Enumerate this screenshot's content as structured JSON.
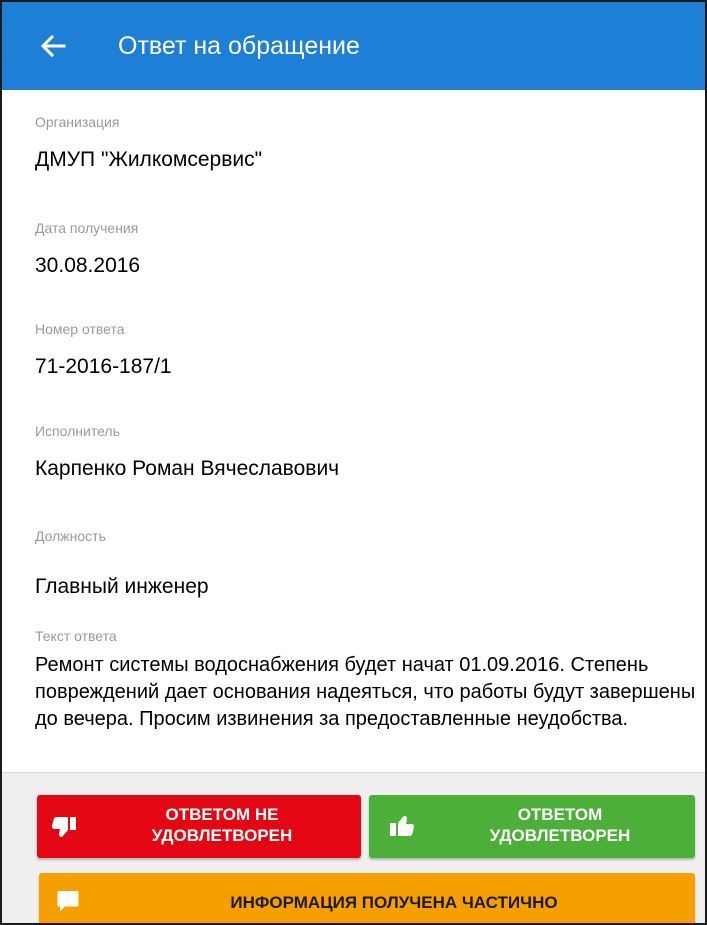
{
  "header": {
    "title": "Ответ на обращение",
    "back_icon": "arrow-left-icon"
  },
  "fields": {
    "organization": {
      "label": "Организация",
      "value": "ДМУП \"Жилкомсервис\""
    },
    "received_date": {
      "label": "Дата получения",
      "value": "30.08.2016"
    },
    "answer_number": {
      "label": "Номер ответа",
      "value": "71-2016-187/1"
    },
    "executor": {
      "label": "Исполнитель",
      "value": "Карпенко Роман Вячеславович"
    },
    "position": {
      "label": "Должность",
      "value": "Главный инженер"
    },
    "answer_text": {
      "label": "Текст ответа",
      "value": "Ремонт системы водоснабжения будет начат 01.09.2016. Степень повреждений дает основания надеяться, что работы будут завершены до вечера. Просим извинения за предоставленные неудобства."
    }
  },
  "actions": {
    "not_satisfied": {
      "line1": "ОТВЕТОМ НЕ",
      "line2": "УДОВЛЕТВОРЕН",
      "icon": "thumbs-down-icon",
      "color": "#e30613"
    },
    "satisfied": {
      "line1": "ОТВЕТОМ",
      "line2": "УДОВЛЕТВОРЕН",
      "icon": "thumbs-up-icon",
      "color": "#4caf3a"
    },
    "partial": {
      "label": "ИНФОРМАЦИЯ ПОЛУЧЕНА ЧАСТИЧНО",
      "icon": "comment-icon",
      "color": "#f5a000"
    }
  },
  "colors": {
    "appbar": "#1e7fd6",
    "label": "#9a9a9a"
  }
}
